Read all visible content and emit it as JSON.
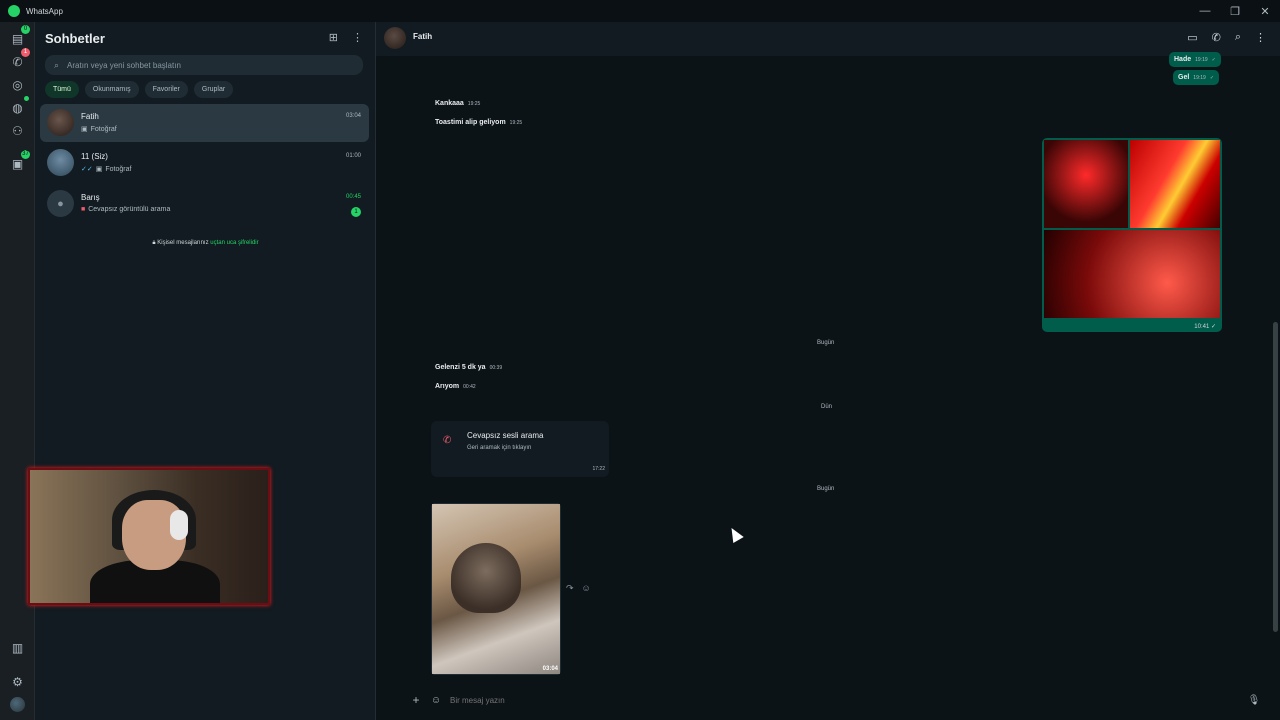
{
  "titlebar": {
    "title": "WhatsApp"
  },
  "rail": {
    "badges": {
      "chats": "0",
      "calls": "1",
      "communities": "37"
    }
  },
  "sidebar": {
    "title": "Sohbetler",
    "search_placeholder": "Aratın veya yeni sohbet başlatın",
    "filters": [
      "Tümü",
      "Okunmamış",
      "Favoriler",
      "Gruplar"
    ],
    "chats": [
      {
        "name": "Fatih",
        "preview": "Fotoğraf",
        "time": "03:04"
      },
      {
        "name": "11 (Siz)",
        "preview": "Fotoğraf",
        "time": "01:00"
      },
      {
        "name": "Barış",
        "preview": "Cevapsız görüntülü arama",
        "time": "00:45",
        "unread": "1"
      }
    ],
    "encryption_note": "Kişisel mesajlarınız",
    "encryption_link": "uçtan uca şifrelidir"
  },
  "conversation": {
    "contact_name": "Fatih",
    "messages": {
      "hade": {
        "text": "Hade",
        "time": "19:19"
      },
      "gel": {
        "text": "Gel",
        "time": "19:19"
      },
      "kankaaa": {
        "text": "Kankaaa",
        "time": "19:25"
      },
      "toast": {
        "text": "Toastimi alip geliyom",
        "time": "19:25"
      },
      "photos_time": "10:41",
      "day1": "Bugün",
      "gelenzi": {
        "text": "Gelenzi 5 dk ya",
        "time": "00:39"
      },
      "ariyom": {
        "text": "Arıyom",
        "time": "00:42"
      },
      "day2": "Dün",
      "call": {
        "title": "Cevapsız sesli arama",
        "subtitle": "Geri aramak için tıklayın",
        "time": "17:22"
      },
      "day3": "Bugün",
      "cat_photo_time": "03:04"
    },
    "composer_placeholder": "Bir mesaj yazın"
  },
  "colors": {
    "accent": "#25d366",
    "outgoing_bubble": "#005c4b",
    "missed_call": "#f15c6d"
  }
}
